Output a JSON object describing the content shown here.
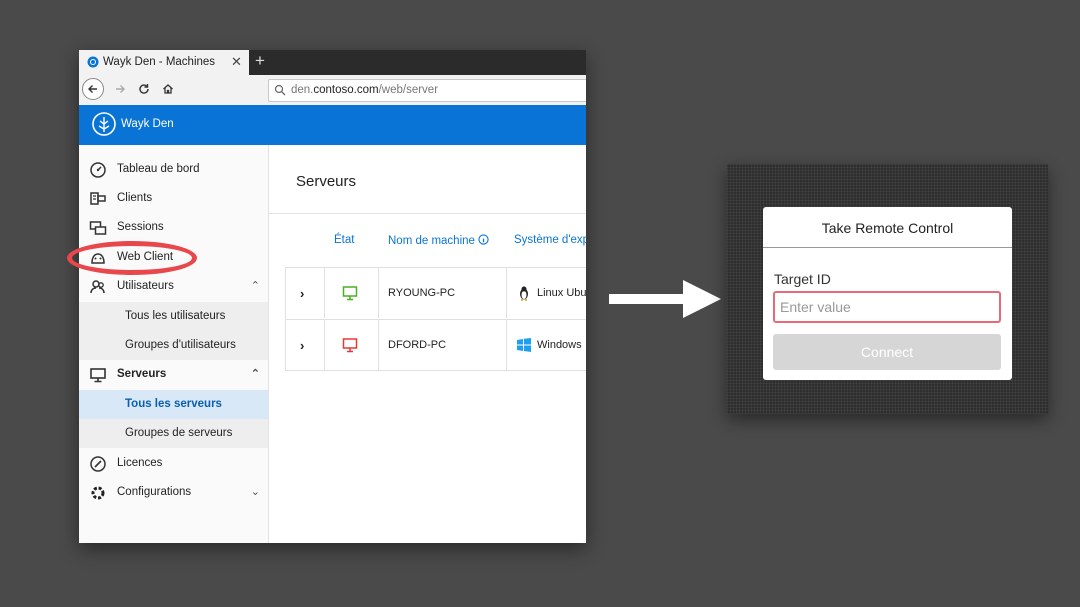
{
  "browser": {
    "tab_title": "Wayk Den - Machines",
    "close_glyph": "✕",
    "newtab_glyph": "+",
    "url_prefix": "den.",
    "url_domain": "contoso.com",
    "url_path": "/web/server"
  },
  "app": {
    "name": "Wayk Den",
    "accent": "#0a74d6"
  },
  "sidebar": {
    "items": [
      {
        "label": "Tableau de bord",
        "icon": "gauge-icon"
      },
      {
        "label": "Clients",
        "icon": "clients-icon"
      },
      {
        "label": "Sessions",
        "icon": "sessions-icon"
      },
      {
        "label": "Web Client",
        "icon": "web-client-icon"
      },
      {
        "label": "Utilisateurs",
        "icon": "users-icon"
      },
      {
        "label": "Tous les utilisateurs"
      },
      {
        "label": "Groupes d'utilisateurs"
      },
      {
        "label": "Serveurs",
        "icon": "monitor-icon"
      },
      {
        "label": "Tous les serveurs"
      },
      {
        "label": "Groupes de serveurs"
      },
      {
        "label": "Licences",
        "icon": "license-icon"
      },
      {
        "label": "Configurations",
        "icon": "gear-icon"
      }
    ]
  },
  "main": {
    "title": "Serveurs",
    "columns": {
      "state": "État",
      "machine": "Nom de machine",
      "os": "Système d'exp"
    },
    "rows": [
      {
        "machine": "RYOUNG-PC",
        "os": "Linux Ubu",
        "state_color": "#4caf24"
      },
      {
        "machine": "DFORD-PC",
        "os": "Windows",
        "state_color": "#e53935"
      }
    ]
  },
  "dialog": {
    "title": "Take Remote Control",
    "label": "Target ID",
    "placeholder": "Enter value",
    "button": "Connect"
  }
}
